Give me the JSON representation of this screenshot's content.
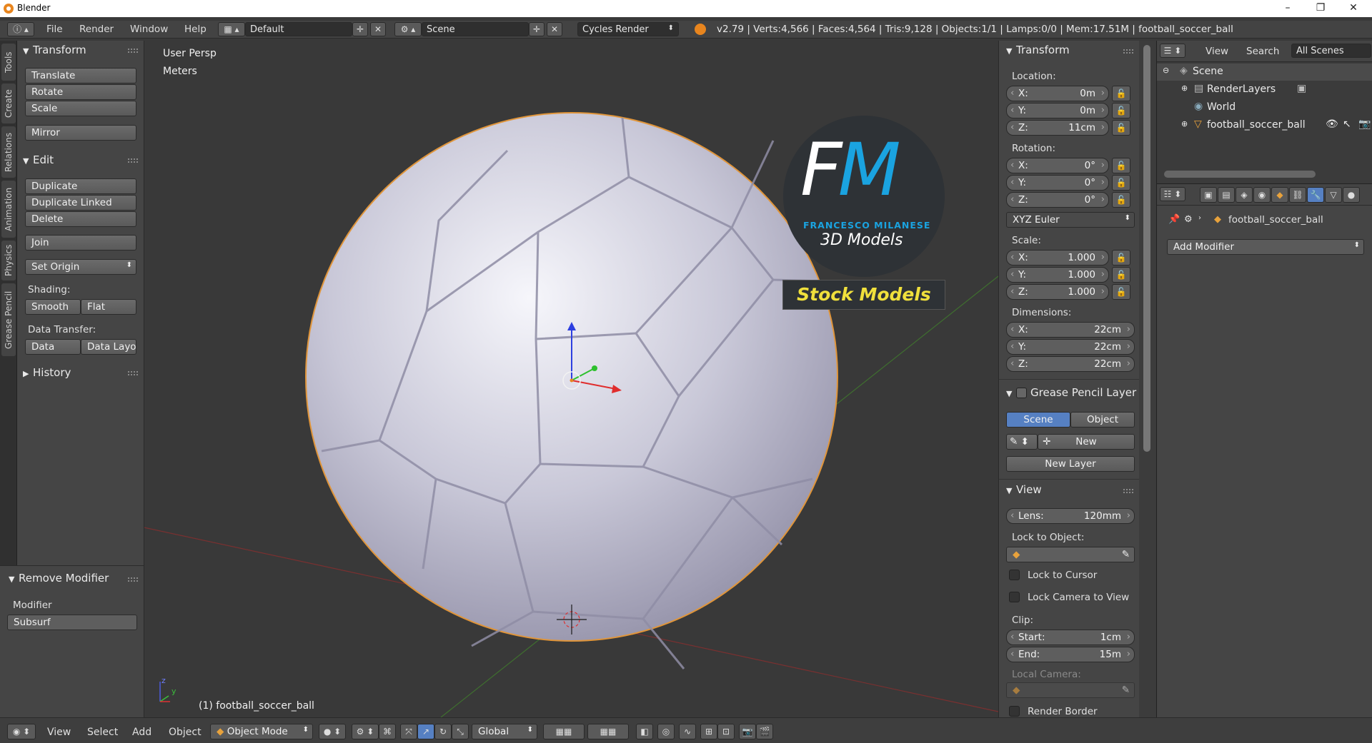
{
  "window": {
    "title": "Blender",
    "minimize": "–",
    "maximize": "❐",
    "close": "✕"
  },
  "menubar": {
    "items": [
      "File",
      "Render",
      "Window",
      "Help"
    ],
    "layout": "Default",
    "scene": "Scene",
    "engine": "Cycles Render",
    "stats": "v2.79 | Verts:4,566 | Faces:4,564 | Tris:9,128 | Objects:1/1 | Lamps:0/0 | Mem:17.51M | football_soccer_ball"
  },
  "side_tabs": [
    "Tools",
    "Create",
    "Relations",
    "Animation",
    "Physics",
    "Grease Pencil"
  ],
  "toolshelf": {
    "transform_title": "Transform",
    "translate": "Translate",
    "rotate": "Rotate",
    "scale": "Scale",
    "mirror": "Mirror",
    "edit_title": "Edit",
    "duplicate": "Duplicate",
    "duplicate_linked": "Duplicate Linked",
    "delete": "Delete",
    "join": "Join",
    "set_origin": "Set Origin",
    "shading_label": "Shading:",
    "smooth": "Smooth",
    "flat": "Flat",
    "data_transfer_label": "Data Transfer:",
    "data": "Data",
    "data_layout": "Data Layo",
    "history_title": "History"
  },
  "operator_panel": {
    "title": "Remove Modifier",
    "modifier_label": "Modifier",
    "modifier_value": "Subsurf"
  },
  "viewport": {
    "view_name": "User Persp",
    "units": "Meters",
    "object_label": "(1) football_soccer_ball",
    "watermark": {
      "fm": "FM",
      "name": "FRANCESCO MILANESE",
      "sub": "3D Models",
      "badge": "Stock Models"
    },
    "axis_y": "y",
    "axis_z": "z"
  },
  "npanel": {
    "transform_title": "Transform",
    "location_label": "Location:",
    "location": [
      {
        "k": "X:",
        "v": "0m"
      },
      {
        "k": "Y:",
        "v": "0m"
      },
      {
        "k": "Z:",
        "v": "11cm"
      }
    ],
    "rotation_label": "Rotation:",
    "rotation": [
      {
        "k": "X:",
        "v": "0°"
      },
      {
        "k": "Y:",
        "v": "0°"
      },
      {
        "k": "Z:",
        "v": "0°"
      }
    ],
    "rotation_mode": "XYZ Euler",
    "scale_label": "Scale:",
    "scale": [
      {
        "k": "X:",
        "v": "1.000"
      },
      {
        "k": "Y:",
        "v": "1.000"
      },
      {
        "k": "Z:",
        "v": "1.000"
      }
    ],
    "dimensions_label": "Dimensions:",
    "dimensions": [
      {
        "k": "X:",
        "v": "22cm"
      },
      {
        "k": "Y:",
        "v": "22cm"
      },
      {
        "k": "Z:",
        "v": "22cm"
      }
    ],
    "gp_title": "Grease Pencil Layer",
    "gp_scene": "Scene",
    "gp_object": "Object",
    "gp_new": "New",
    "gp_new_layer": "New Layer",
    "view_title": "View",
    "lens_label": "Lens:",
    "lens_value": "120mm",
    "lock_object_label": "Lock to Object:",
    "lock_cursor": "Lock to Cursor",
    "lock_camera": "Lock Camera to View",
    "clip_label": "Clip:",
    "clip_start_label": "Start:",
    "clip_start": "1cm",
    "clip_end_label": "End:",
    "clip_end": "15m",
    "local_camera_label": "Local Camera:",
    "render_border": "Render Border"
  },
  "outliner": {
    "view": "View",
    "search": "Search",
    "filter": "All Scenes",
    "items": [
      "Scene",
      "RenderLayers",
      "World",
      "football_soccer_ball"
    ]
  },
  "properties": {
    "object_name": "football_soccer_ball",
    "add_modifier": "Add Modifier"
  },
  "footer": {
    "view": "View",
    "select": "Select",
    "add": "Add",
    "object": "Object",
    "mode": "Object Mode",
    "orientation": "Global"
  },
  "colors": {
    "accent_blue": "#5680c2",
    "orange": "#e8851e",
    "fm_blue": "#1aa3e0",
    "badge_yellow": "#f0e03c"
  }
}
